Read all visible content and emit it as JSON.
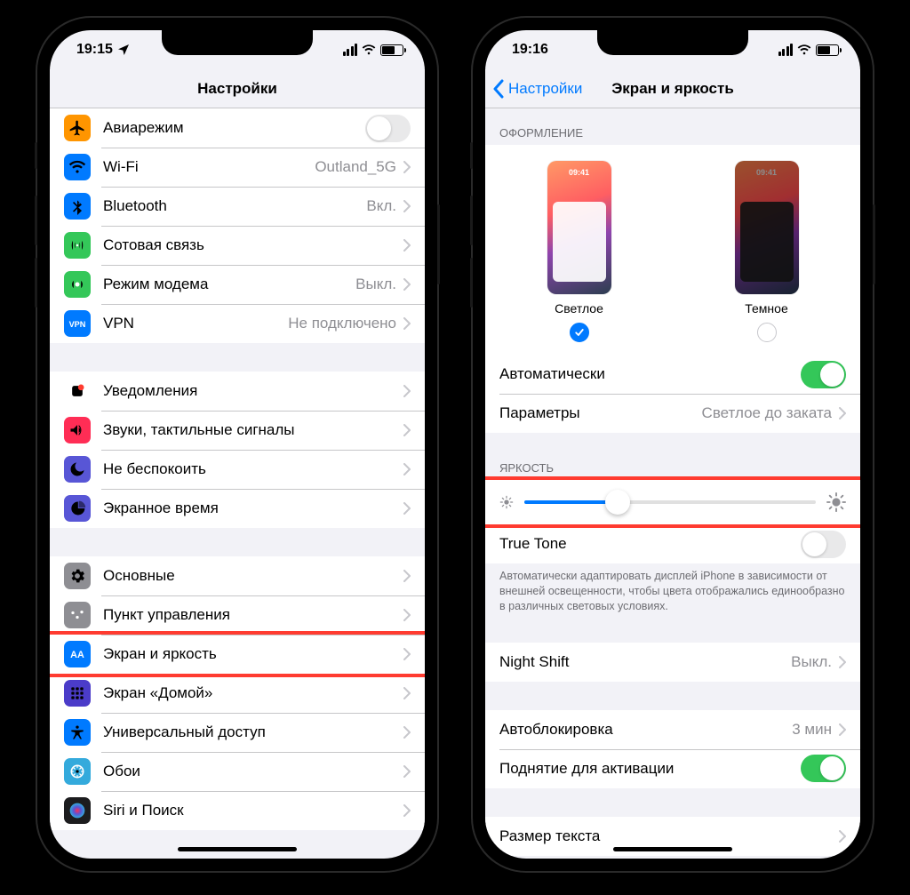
{
  "phone1": {
    "time": "19:15",
    "title": "Настройки",
    "groups": [
      {
        "rows": [
          {
            "icon": "airplane",
            "label": "Авиарежим",
            "toggle": "off"
          },
          {
            "icon": "wifi",
            "label": "Wi-Fi",
            "detail": "Outland_5G"
          },
          {
            "icon": "bluetooth",
            "label": "Bluetooth",
            "detail": "Вкл."
          },
          {
            "icon": "cellular",
            "label": "Сотовая связь"
          },
          {
            "icon": "hotspot",
            "label": "Режим модема",
            "detail": "Выкл."
          },
          {
            "icon": "vpn",
            "label": "VPN",
            "detail": "Не подключено"
          }
        ]
      },
      {
        "rows": [
          {
            "icon": "notifications",
            "label": "Уведомления"
          },
          {
            "icon": "sounds",
            "label": "Звуки, тактильные сигналы"
          },
          {
            "icon": "dnd",
            "label": "Не беспокоить"
          },
          {
            "icon": "screentime",
            "label": "Экранное время"
          }
        ]
      },
      {
        "rows": [
          {
            "icon": "general",
            "label": "Основные"
          },
          {
            "icon": "control",
            "label": "Пункт управления"
          },
          {
            "icon": "display",
            "label": "Экран и яркость",
            "highlight": true
          },
          {
            "icon": "home",
            "label": "Экран «Домой»"
          },
          {
            "icon": "accessibility",
            "label": "Универсальный доступ"
          },
          {
            "icon": "wallpaper",
            "label": "Обои"
          },
          {
            "icon": "siri",
            "label": "Siri и Поиск"
          }
        ]
      }
    ]
  },
  "phone2": {
    "time": "19:16",
    "back": "Настройки",
    "title": "Экран и яркость",
    "appearance": {
      "header": "ОФОРМЛЕНИЕ",
      "mini_time": "09:41",
      "light": "Светлое",
      "dark": "Темное",
      "auto_label": "Автоматически",
      "auto_on": true,
      "options_label": "Параметры",
      "options_detail": "Светлое до заката"
    },
    "brightness": {
      "header": "ЯРКОСТЬ",
      "slider_pct": 32,
      "truetone_label": "True Tone",
      "truetone_on": false,
      "truetone_desc": "Автоматически адаптировать дисплей iPhone в зависимости от внешней освещенности, чтобы цвета отображались единообразно в различных световых условиях."
    },
    "nightshift": {
      "label": "Night Shift",
      "detail": "Выкл."
    },
    "autolock": {
      "label": "Автоблокировка",
      "detail": "3 мин"
    },
    "raise": {
      "label": "Поднятие для активации",
      "on": true
    },
    "textsize": {
      "label": "Размер текста"
    }
  },
  "icon_colors": {
    "airplane": "#ff9500",
    "wifi": "#007aff",
    "bluetooth": "#007aff",
    "cellular": "#34c759",
    "hotspot": "#34c759",
    "vpn": "#007aff",
    "notifications": "#ff3b30",
    "sounds": "#ff2d55",
    "dnd": "#5856d6",
    "screentime": "#5856d6",
    "general": "#8e8e93",
    "control": "#8e8e93",
    "display": "#007aff",
    "home": "#4b3cc9",
    "accessibility": "#007aff",
    "wallpaper": "#34aadc",
    "siri": "#1c1c1e"
  }
}
